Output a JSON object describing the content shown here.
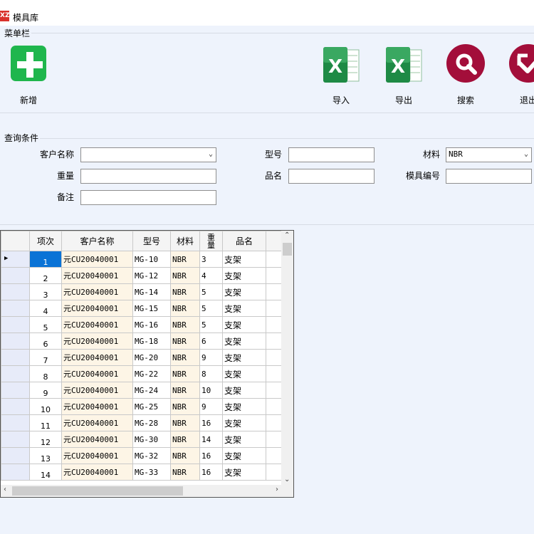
{
  "window": {
    "icon_text": "XZ",
    "title": "模具库"
  },
  "toolbar": {
    "group_label": "菜单栏",
    "add_label": "新增",
    "import_label": "导入",
    "export_label": "导出",
    "search_label": "搜索",
    "exit_label": "退出"
  },
  "query": {
    "group_label": "查询条件",
    "customer_label": "客户名称",
    "customer_value": "",
    "model_label": "型号",
    "model_value": "",
    "material_label": "材料",
    "material_value": "NBR",
    "weight_label": "重量",
    "weight_value": "",
    "product_label": "品名",
    "product_value": "",
    "mold_no_label": "模具编号",
    "mold_no_value": "",
    "remark_label": "备注",
    "remark_value": ""
  },
  "grid": {
    "columns": [
      "项次",
      "客户名称",
      "型号",
      "材料",
      "重量",
      "品名"
    ],
    "rows": [
      {
        "idx": "1",
        "customer": "元CU20040001",
        "model": "MG-10",
        "material": "NBR",
        "weight": "3",
        "name": "支架"
      },
      {
        "idx": "2",
        "customer": "元CU20040001",
        "model": "MG-12",
        "material": "NBR",
        "weight": "4",
        "name": "支架"
      },
      {
        "idx": "3",
        "customer": "元CU20040001",
        "model": "MG-14",
        "material": "NBR",
        "weight": "5",
        "name": "支架"
      },
      {
        "idx": "4",
        "customer": "元CU20040001",
        "model": "MG-15",
        "material": "NBR",
        "weight": "5",
        "name": "支架"
      },
      {
        "idx": "5",
        "customer": "元CU20040001",
        "model": "MG-16",
        "material": "NBR",
        "weight": "5",
        "name": "支架"
      },
      {
        "idx": "6",
        "customer": "元CU20040001",
        "model": "MG-18",
        "material": "NBR",
        "weight": "6",
        "name": "支架"
      },
      {
        "idx": "7",
        "customer": "元CU20040001",
        "model": "MG-20",
        "material": "NBR",
        "weight": "9",
        "name": "支架"
      },
      {
        "idx": "8",
        "customer": "元CU20040001",
        "model": "MG-22",
        "material": "NBR",
        "weight": "8",
        "name": "支架"
      },
      {
        "idx": "9",
        "customer": "元CU20040001",
        "model": "MG-24",
        "material": "NBR",
        "weight": "10",
        "name": "支架"
      },
      {
        "idx": "10",
        "customer": "元CU20040001",
        "model": "MG-25",
        "material": "NBR",
        "weight": "9",
        "name": "支架"
      },
      {
        "idx": "11",
        "customer": "元CU20040001",
        "model": "MG-28",
        "material": "NBR",
        "weight": "16",
        "name": "支架"
      },
      {
        "idx": "12",
        "customer": "元CU20040001",
        "model": "MG-30",
        "material": "NBR",
        "weight": "14",
        "name": "支架"
      },
      {
        "idx": "13",
        "customer": "元CU20040001",
        "model": "MG-32",
        "material": "NBR",
        "weight": "16",
        "name": "支架"
      },
      {
        "idx": "14",
        "customer": "元CU20040001",
        "model": "MG-33",
        "material": "NBR",
        "weight": "16",
        "name": "支架"
      }
    ]
  },
  "colors": {
    "selected_cell": "#0a73d6",
    "add_icon": "#1fb64d",
    "round_icon": "#a30e3a",
    "excel_green": "#1e8a45"
  }
}
